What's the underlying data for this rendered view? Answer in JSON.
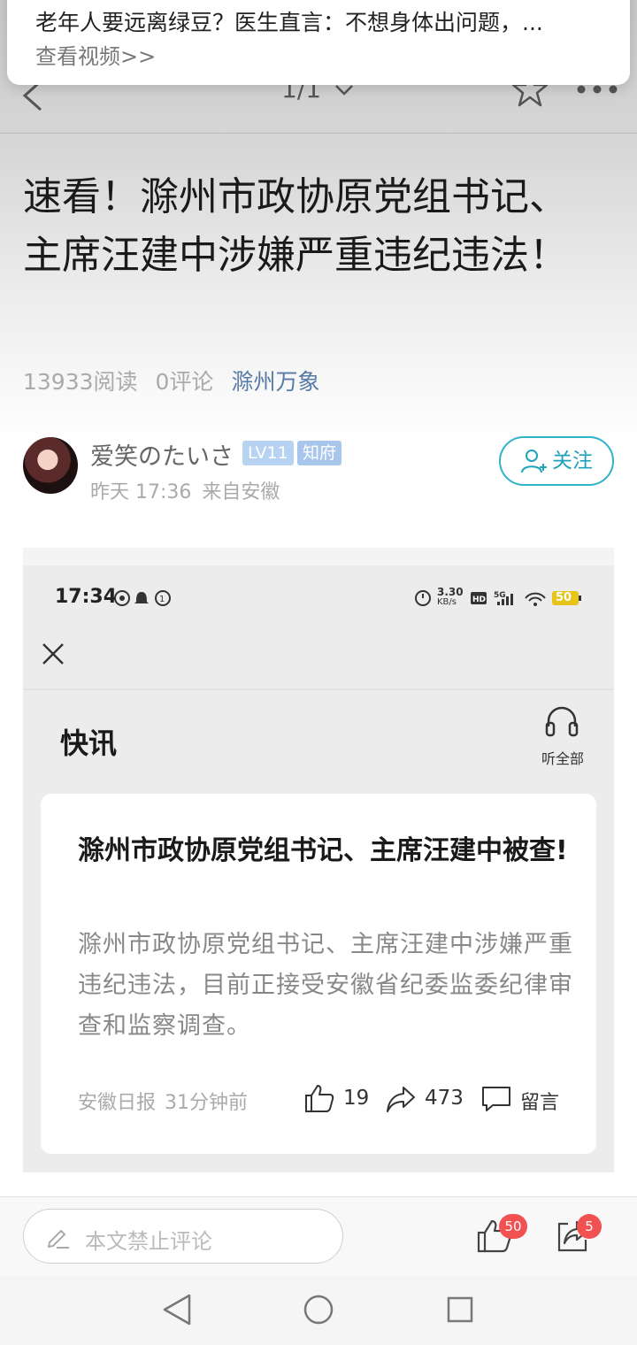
{
  "popup": {
    "title": "老年人要远离绿豆？医生直言：不想身体出问题，...",
    "link": "查看视频>>"
  },
  "nav": {
    "page_indicator": "1/1"
  },
  "article": {
    "title": "速看！滁州市政协原党组书记、主席汪建中涉嫌严重违纪违法！",
    "reads": "13933阅读",
    "comments": "0评论",
    "source": "滁州万象"
  },
  "author": {
    "name": "爱笑のたいさ",
    "level": "LV11",
    "title_badge": "知府",
    "time": "昨天 17:36",
    "location": "来自安徽",
    "follow_label": "关注"
  },
  "screenshot": {
    "status_time": "17:34",
    "net_speed": "3.30",
    "net_unit": "KB/s",
    "battery": "50",
    "section_title": "快讯",
    "listen_label": "听全部",
    "card": {
      "title": "滁州市政协原党组书记、主席汪建中被查!",
      "body": "滁州市政协原党组书记、主席汪建中涉嫌严重违纪违法，目前正接受安徽省纪委监委纪律审查和监察调查。",
      "source": "安徽日报",
      "time": "31分钟前",
      "likes": "19",
      "shares": "473",
      "comment_label": "留言"
    }
  },
  "bottom": {
    "comment_placeholder": "本文禁止评论",
    "like_badge": "50",
    "share_badge": "5"
  },
  "colors": {
    "accent_follow": "#31b3c8",
    "source_link": "#577aa6",
    "badge_red": "#f25151"
  }
}
